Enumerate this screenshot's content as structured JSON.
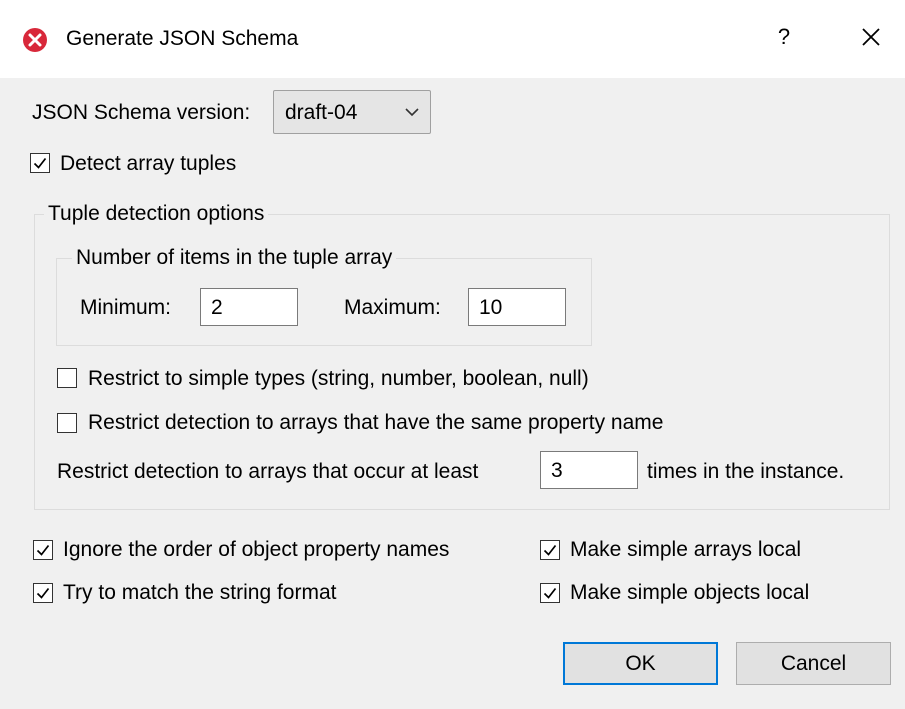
{
  "window": {
    "title": "Generate JSON Schema",
    "help_glyph": "?",
    "close_glyph": "✕",
    "app_icon": "close-circle-icon",
    "accent": "#0078d7",
    "app_icon_color": "#d8283a"
  },
  "schema_version": {
    "label": "JSON Schema version:",
    "selected": "draft-04"
  },
  "detect_array_tuples": {
    "label": "Detect array tuples",
    "checked": true
  },
  "tuple_options": {
    "legend": "Tuple detection options",
    "items_group": {
      "legend": "Number of items in the tuple array",
      "minimum_label": "Minimum:",
      "minimum_value": "2",
      "maximum_label": "Maximum:",
      "maximum_value": "10"
    },
    "restrict_simple_types": {
      "label": "Restrict to simple types (string, number, boolean, null)",
      "checked": false
    },
    "restrict_same_name": {
      "label": "Restrict detection to arrays that have the same property name",
      "checked": false
    },
    "occur_at_least": {
      "prefix": "Restrict detection to arrays that occur at least",
      "value": "3",
      "suffix": "times in the instance."
    }
  },
  "options": {
    "ignore_order": {
      "label": "Ignore the order of object property names",
      "checked": true
    },
    "match_string_format": {
      "label": "Try to match the string format",
      "checked": true
    },
    "simple_arrays_local": {
      "label": "Make simple arrays local",
      "checked": true
    },
    "simple_objects_local": {
      "label": "Make simple objects local",
      "checked": true
    }
  },
  "buttons": {
    "ok": "OK",
    "cancel": "Cancel"
  }
}
